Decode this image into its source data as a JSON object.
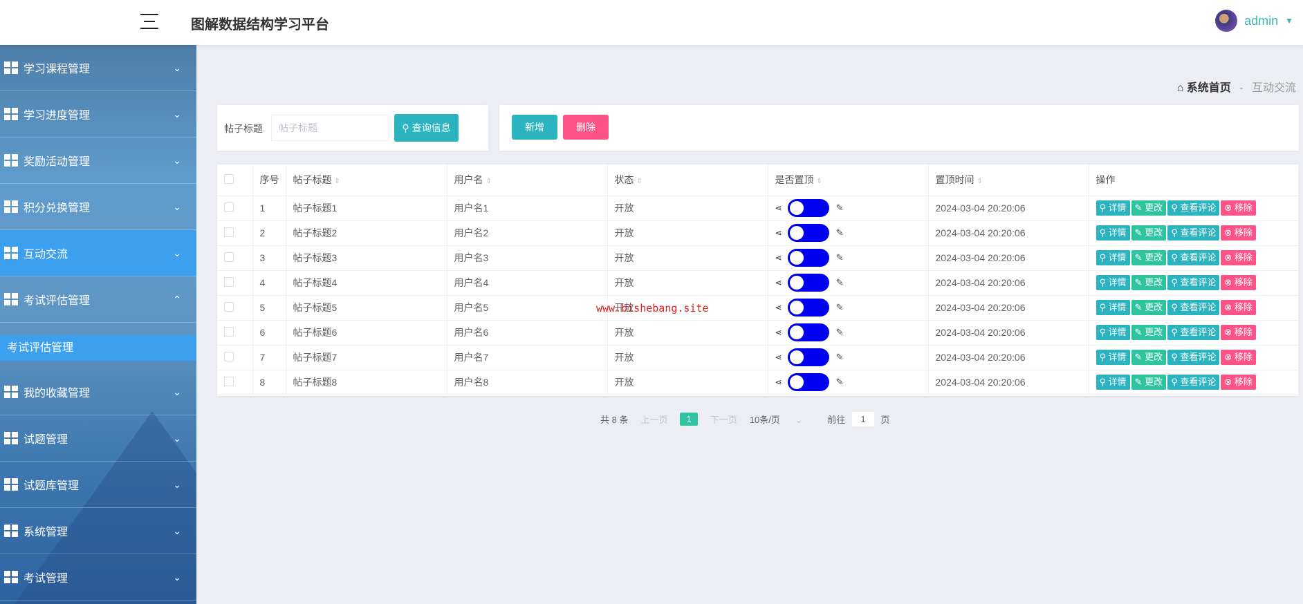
{
  "header": {
    "title": "图解数据结构学习平台",
    "user": "admin"
  },
  "sidebar": {
    "items": [
      {
        "label": "学习课程管理",
        "icon": "grid-icon",
        "chevron": "⌄"
      },
      {
        "label": "学习进度管理",
        "icon": "grid-icon",
        "chevron": "⌄"
      },
      {
        "label": "奖励活动管理",
        "icon": "briefcase-icon",
        "chevron": "⌄"
      },
      {
        "label": "积分兑换管理",
        "icon": "list-icon",
        "chevron": "⌄"
      },
      {
        "label": "互动交流",
        "icon": "sliders-icon",
        "chevron": "⌄",
        "active": true
      },
      {
        "label": "考试评估管理",
        "icon": "grid-icon",
        "chevron": "⌃"
      },
      {
        "label": "我的收藏管理",
        "icon": "grid-icon",
        "chevron": "⌄"
      },
      {
        "label": "试题管理",
        "icon": "grid-icon",
        "chevron": "⌄"
      },
      {
        "label": "试题库管理",
        "icon": "book-icon",
        "chevron": "⌄"
      },
      {
        "label": "系统管理",
        "icon": "monitor-icon",
        "chevron": "⌄"
      },
      {
        "label": "考试管理",
        "icon": "briefcase-icon",
        "chevron": "⌄"
      }
    ],
    "submenu": "考试评估管理"
  },
  "breadcrumb": {
    "home": "系统首页",
    "sep": "-",
    "current": "互动交流"
  },
  "search": {
    "label": "帖子标题",
    "placeholder": "帖子标题",
    "button": "查询信息"
  },
  "actions": {
    "add": "新增",
    "delete": "删除"
  },
  "table": {
    "headers": [
      "序号",
      "帖子标题",
      "用户名",
      "状态",
      "是否置顶",
      "置顶时间",
      "操作"
    ],
    "rows": [
      {
        "no": "1",
        "title": "帖子标题1",
        "user": "用户名1",
        "status": "开放",
        "time": "2024-03-04 20:20:06"
      },
      {
        "no": "2",
        "title": "帖子标题2",
        "user": "用户名2",
        "status": "开放",
        "time": "2024-03-04 20:20:06"
      },
      {
        "no": "3",
        "title": "帖子标题3",
        "user": "用户名3",
        "status": "开放",
        "time": "2024-03-04 20:20:06"
      },
      {
        "no": "4",
        "title": "帖子标题4",
        "user": "用户名4",
        "status": "开放",
        "time": "2024-03-04 20:20:06"
      },
      {
        "no": "5",
        "title": "帖子标题5",
        "user": "用户名5",
        "status": "开放",
        "time": "2024-03-04 20:20:06"
      },
      {
        "no": "6",
        "title": "帖子标题6",
        "user": "用户名6",
        "status": "开放",
        "time": "2024-03-04 20:20:06"
      },
      {
        "no": "7",
        "title": "帖子标题7",
        "user": "用户名7",
        "status": "开放",
        "time": "2024-03-04 20:20:06"
      },
      {
        "no": "8",
        "title": "帖子标题8",
        "user": "用户名8",
        "status": "开放",
        "time": "2024-03-04 20:20:06"
      }
    ],
    "row_actions": [
      "详情",
      "更改",
      "查看评论",
      "移除"
    ],
    "toggle_on": true
  },
  "pagination": {
    "total": "共 8 条",
    "prev": "上一页",
    "page": "1",
    "next": "下一页",
    "size": "10条/页",
    "goto": "前往",
    "goto_value": "1",
    "page_unit": "页"
  },
  "watermark": "www.bishebang.site",
  "colors": {
    "teal": "#2bb4bf",
    "green": "#2ec4a0",
    "pink": "#fc5488",
    "toggle": "#0000f0",
    "sidebar_active": "#3ca0ef"
  }
}
